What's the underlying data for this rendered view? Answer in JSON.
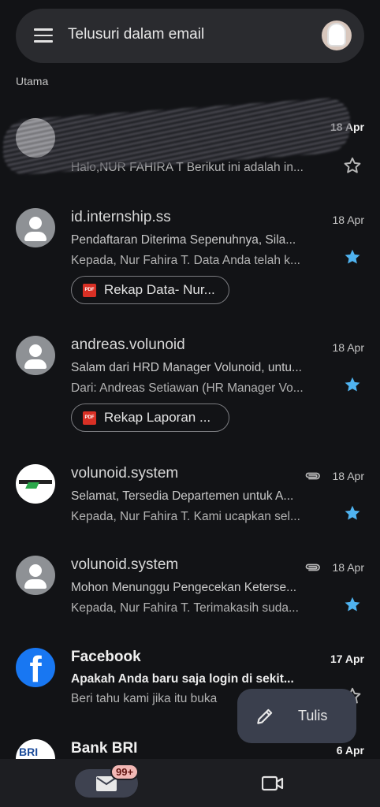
{
  "search": {
    "placeholder": "Telusuri dalam email"
  },
  "section_label": "Utama",
  "emails": [
    {
      "sender": "",
      "date": "18 Apr",
      "subject": "",
      "snippet": "Halo,NUR FAHIRA T Berikut ini adalah in...",
      "starred": false,
      "unread": true,
      "redacted": true
    },
    {
      "sender": "id.internship.ss",
      "date": "18 Apr",
      "subject": "Pendaftaran Diterima Sepenuhnya, Sila...",
      "snippet": "Kepada, Nur Fahira T. Data Anda telah k...",
      "starred": true,
      "unread": false,
      "attachment": "Rekap Data- Nur..."
    },
    {
      "sender": "andreas.volunoid",
      "date": "18 Apr",
      "subject": "Salam dari HRD Manager Volunoid, untu...",
      "snippet": "Dari: Andreas Setiawan (HR Manager Vo...",
      "starred": true,
      "unread": false,
      "attachment": "Rekap Laporan ..."
    },
    {
      "sender": "volunoid.system",
      "date": "18 Apr",
      "subject": "Selamat, Tersedia Departemen untuk A...",
      "snippet": "Kepada, Nur Fahira T. Kami ucapkan sel...",
      "starred": true,
      "unread": false,
      "has_clip": true
    },
    {
      "sender": "volunoid.system",
      "date": "18 Apr",
      "subject": "Mohon Menunggu Pengecekan Keterse...",
      "snippet": "Kepada, Nur Fahira T. Terimakasih suda...",
      "starred": true,
      "unread": false,
      "has_clip": true
    },
    {
      "sender": "Facebook",
      "date": "17 Apr",
      "subject": "Apakah Anda baru saja login di sekit...",
      "snippet": "Beri tahu kami jika itu buka",
      "starred": false,
      "unread": true
    },
    {
      "sender": "Bank BRI",
      "date": "6 Apr",
      "subject": "",
      "snippet": "",
      "starred": false,
      "unread": true
    }
  ],
  "fab": {
    "label": "Tulis"
  },
  "bottom_nav": {
    "mail_badge": "99+"
  },
  "colors": {
    "background": "#121316",
    "star_active": "#4fb3f0",
    "fab": "#3a3f4d",
    "badge": "#f2b8b5"
  },
  "icons": [
    "menu-icon",
    "search-icon",
    "star-icon",
    "paperclip-icon",
    "pdf-icon",
    "pencil-icon",
    "mail-icon",
    "video-icon"
  ]
}
